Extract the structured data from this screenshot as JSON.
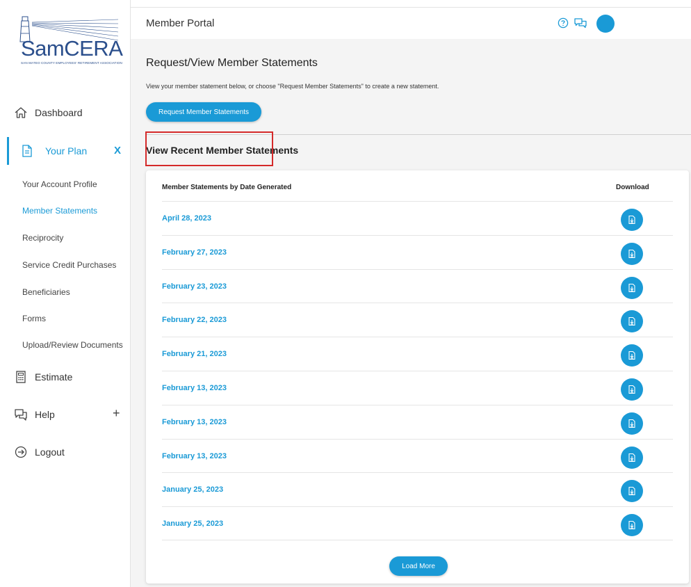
{
  "brand": {
    "name": "SamCERA",
    "subtitle": "SAN MATEO COUNTY EMPLOYEES' RETIREMENT ASSOCIATION",
    "accent_color": "#1a9ad6",
    "logo_color": "#2b4f8c",
    "highlight_color": "#d42a2a"
  },
  "header": {
    "title": "Member Portal",
    "help_icon": "help-circle-icon",
    "chat_icon": "chat-icon",
    "avatar_icon": "avatar"
  },
  "sidebar": {
    "dashboard": {
      "label": "Dashboard",
      "icon": "home-icon"
    },
    "your_plan": {
      "label": "Your Plan",
      "icon": "document-icon",
      "toggle": "X"
    },
    "sub_items": [
      {
        "label": "Your Account Profile"
      },
      {
        "label": "Member Statements"
      },
      {
        "label": "Reciprocity"
      },
      {
        "label": "Service Credit Purchases"
      },
      {
        "label": "Beneficiaries"
      },
      {
        "label": "Forms"
      },
      {
        "label": "Upload/Review Documents"
      }
    ],
    "estimate": {
      "label": "Estimate",
      "icon": "calculator-icon"
    },
    "help": {
      "label": "Help",
      "icon": "chat-icon",
      "toggle": "+"
    },
    "logout": {
      "label": "Logout",
      "icon": "logout-icon"
    }
  },
  "main": {
    "title": "Request/View Member Statements",
    "description": "View your member statement below, or choose \"Request Member Statements\" to create a new statement.",
    "request_button": "Request Member Statements",
    "section_title": "View Recent Member Statements",
    "table": {
      "col_date": "Member Statements by Date Generated",
      "col_download": "Download",
      "rows": [
        "April 28, 2023",
        "February 27, 2023",
        "February 23, 2023",
        "February 22, 2023",
        "February 21, 2023",
        "February 13, 2023",
        "February 13, 2023",
        "February 13, 2023",
        "January 25, 2023",
        "January 25, 2023"
      ]
    },
    "load_more": "Load More"
  }
}
